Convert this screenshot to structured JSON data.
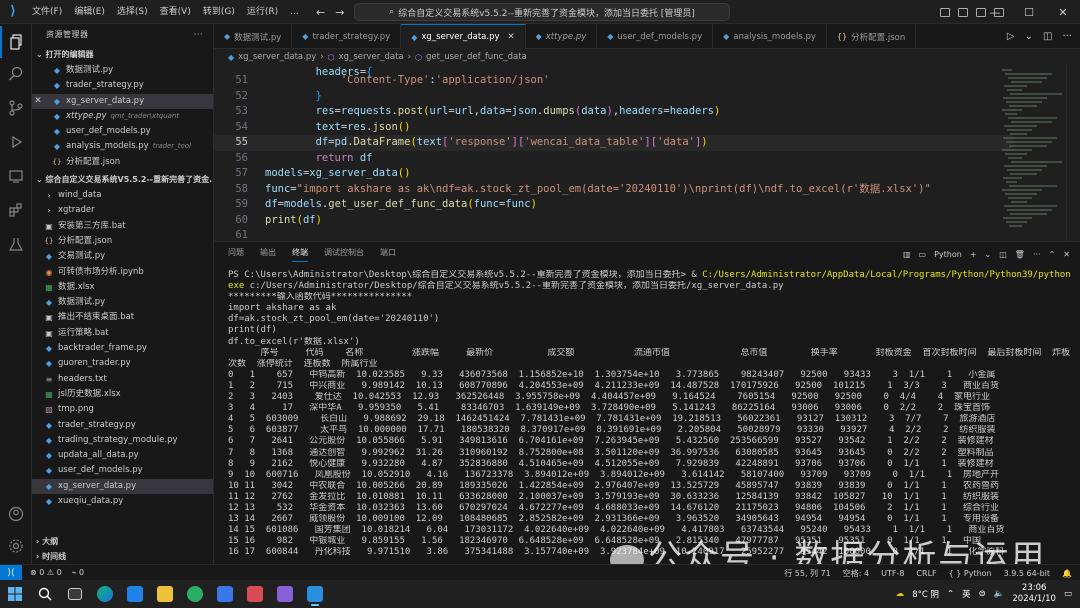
{
  "titlebar": {
    "menus": [
      "文件(F)",
      "编辑(E)",
      "选择(S)",
      "查看(V)",
      "转到(G)",
      "运行(R)",
      "..."
    ],
    "command_center": "综合自定义交易系统v5.5.2--重新完善了资金模块，添加当日委托 [管理员]"
  },
  "sidebar": {
    "title": "资源管理器",
    "open_editors_header": "打开的编辑器",
    "open_editors": [
      {
        "name": "数据测试.py",
        "type": "py",
        "hint": "",
        "italic": false
      },
      {
        "name": "trader_strategy.py",
        "type": "py",
        "hint": "",
        "italic": false
      },
      {
        "name": "xg_server_data.py",
        "type": "py",
        "hint": "",
        "italic": false
      },
      {
        "name": "xttype.py",
        "type": "py",
        "hint": "qmt_trader\\xtquant",
        "italic": true
      },
      {
        "name": "user_def_models.py",
        "type": "py",
        "hint": "",
        "italic": false
      },
      {
        "name": "analysis_models.py",
        "type": "py",
        "hint": "trader_tool",
        "italic": false
      },
      {
        "name": "分析配置.json",
        "type": "json",
        "hint": "",
        "italic": false
      }
    ],
    "workspace_header": "综合自定义交易系统V5.5.2--重新完善了资金...",
    "files": [
      {
        "name": "wind_data",
        "type": "folder"
      },
      {
        "name": "xgtrader",
        "type": "folder"
      },
      {
        "name": "安装第三方库.bat",
        "type": "bat"
      },
      {
        "name": "分析配置.json",
        "type": "json"
      },
      {
        "name": "交易测试.py",
        "type": "py"
      },
      {
        "name": "可转债市场分析.ipynb",
        "type": "ipynb"
      },
      {
        "name": "数据.xlsx",
        "type": "xlsx"
      },
      {
        "name": "数据测试.py",
        "type": "py"
      },
      {
        "name": "推出不结束桌面.bat",
        "type": "bat"
      },
      {
        "name": "运行策略.bat",
        "type": "bat"
      },
      {
        "name": "backtrader_frame.py",
        "type": "py"
      },
      {
        "name": "guoren_trader.py",
        "type": "py"
      },
      {
        "name": "headers.txt",
        "type": "txt"
      },
      {
        "name": "jsl历史数据.xlsx",
        "type": "xlsx"
      },
      {
        "name": "tmp.png",
        "type": "png"
      },
      {
        "name": "trader_strategy.py",
        "type": "py"
      },
      {
        "name": "trading_strategy_module.py",
        "type": "py"
      },
      {
        "name": "updata_all_data.py",
        "type": "py"
      },
      {
        "name": "user_def_models.py",
        "type": "py"
      },
      {
        "name": "xg_server_data.py",
        "type": "py"
      },
      {
        "name": "xueqiu_data.py",
        "type": "py"
      }
    ],
    "outline": "大纲",
    "timeline": "时间线"
  },
  "tabs": [
    {
      "label": "数据测试.py",
      "type": "py",
      "active": false,
      "italic": false
    },
    {
      "label": "trader_strategy.py",
      "type": "py",
      "active": false,
      "italic": false
    },
    {
      "label": "xg_server_data.py",
      "type": "py",
      "active": true,
      "italic": false
    },
    {
      "label": "xttype.py",
      "type": "py",
      "active": false,
      "italic": true
    },
    {
      "label": "user_def_models.py",
      "type": "py",
      "active": false,
      "italic": false
    },
    {
      "label": "analysis_models.py",
      "type": "py",
      "active": false,
      "italic": false
    },
    {
      "label": "分析配置.json",
      "type": "json",
      "active": false,
      "italic": false
    }
  ],
  "breadcrumb": [
    "xg_server_data.py",
    "xg_server_data",
    "get_user_def_func_data"
  ],
  "code_lines": [
    {
      "n": "51",
      "html": "<span class=\"str\">            'Content-Type'</span><span class=\"op\">:</span><span class=\"str\">'application/json'</span>"
    },
    {
      "n": "52",
      "html": "<span class=\"br2\">        }</span>"
    },
    {
      "n": "53",
      "html": "<span class=\"var\">        res</span><span class=\"op\">=</span><span class=\"var\">requests</span><span class=\"op\">.</span><span class=\"fn\">post</span><span class=\"br3\">(</span><span class=\"var\">url</span><span class=\"op\">=</span><span class=\"var\">url</span><span class=\"op\">,</span><span class=\"var\">data</span><span class=\"op\">=</span><span class=\"var\">json</span><span class=\"op\">.</span><span class=\"fn\">dumps</span><span class=\"br\">(</span><span class=\"var\">data</span><span class=\"br\">)</span><span class=\"op\">,</span><span class=\"var\">headers</span><span class=\"op\">=</span><span class=\"var\">headers</span><span class=\"br3\">)</span>"
    },
    {
      "n": "54",
      "html": "<span class=\"var\">        text</span><span class=\"op\">=</span><span class=\"var\">res</span><span class=\"op\">.</span><span class=\"fn\">json</span><span class=\"br3\">()</span>"
    },
    {
      "n": "55",
      "html": "<span class=\"var\">        df</span><span class=\"op\">=</span><span class=\"var\">pd</span><span class=\"op\">.</span><span class=\"fn\">DataFrame</span><span class=\"br3\">(</span><span class=\"var\">text</span><span class=\"br\">[</span><span class=\"str\">'response'</span><span class=\"br\">]</span><span class=\"br\">[</span><span class=\"str\">'wencai_data_table'</span><span class=\"br\">]</span><span class=\"br\">[</span><span class=\"str\">'data'</span><span class=\"br\">]</span><span class=\"br3\">)</span>"
    },
    {
      "n": "56",
      "html": "<span class=\"kw\">        return</span><span class=\"var\"> df</span>"
    },
    {
      "n": "57",
      "html": "<span class=\"var\">models</span><span class=\"op\">=</span><span class=\"var\">xg_server_data</span><span class=\"br3\">()</span>"
    },
    {
      "n": "58",
      "html": "<span class=\"var\">func</span><span class=\"op\">=</span><span class=\"str\">\"import akshare as ak\\ndf=ak.stock_zt_pool_em(date='20240110')\\nprint(df)\\ndf.to_excel(r'数据.xlsx')\"</span>"
    },
    {
      "n": "59",
      "html": "<span class=\"var\">df</span><span class=\"op\">=</span><span class=\"var\">models</span><span class=\"op\">.</span><span class=\"fn\">get_user_def_func_data</span><span class=\"br3\">(</span><span class=\"var\">func</span><span class=\"op\">=</span><span class=\"var\">func</span><span class=\"br3\">)</span>"
    },
    {
      "n": "60",
      "html": "<span class=\"fn\">print</span><span class=\"br3\">(</span><span class=\"var\">df</span><span class=\"br3\">)</span>"
    },
    {
      "n": "61",
      "html": ""
    }
  ],
  "current_line": "55",
  "panel": {
    "tabs": [
      "问题",
      "输出",
      "终端",
      "调试控制台",
      "端口"
    ],
    "active_tab": "终端",
    "shell_label": "Python",
    "terminal_lines": [
      "PS C:\\Users\\Administrator\\Desktop\\综合自定义交易系统v5.5.2--重新完善了资金模块，添加当日委托> & C:/Users/Administrator/AppData/Local/Programs/Python/Python39/python.",
      "exe c:/Users/Administrator/Desktop/综合自定义交易系统v5.5.2--重新完善了资金模块，添加当日委托/xg_server_data.py",
      "*********输入函数代码***************",
      "import akshare as ak",
      "df=ak.stock_zt_pool_em(date='20240110')",
      "print(df)",
      "df.to_excel(r'数据.xlsx')",
      "      序号     代码    名称         涨跌幅     最新价          成交额           流通市值             总市值        换手率       封板资金  首次封板时间  最后封板时间  炸板",
      "次数  涨停统计  连板数  所属行业",
      "0   1    657   中钨高新  10.023585   9.33   436073568  1.156852e+10  1.303754e+10   3.773865    98243407   92500   93433    3  1/1    1   小金属",
      "1   2    715   中兴商业   9.989142  10.13   608770896  4.204553e+09  4.211233e+09  14.487528  170175926   92500  101215    1  3/3    3   商业百货",
      "2   3   2403    爱仕达  10.042553  12.93   362526448  3.955758e+09  4.404457e+09   9.164524    7605154   92500   92500    0  4/4    4  家电行业",
      "3   4     17   深中华A   9.959350   5.41    83346703  1.639149e+09  3.728490e+09   5.141243   86225164   93006   93006    0  2/2    2  珠宝首饰",
      "4   5  603009    长白山   9.988692  29.18  1462451424  7.781431e+09  7.781431e+09  19.218513   56022361   93127  130312    3  7/7    7  旅游酒店",
      "5   6  603877    太平鸟  10.000000  17.71   180538320  8.370917e+09  8.391691e+09   2.205804   50028979   93330   93927    4  2/2    2  纺织服装",
      "6   7   2641   公元股份  10.055866   5.91   349813616  6.704161e+09  7.263945e+09   5.432560  253566599   93527   93542    1  2/2    2  装修建材",
      "7   8   1368   通达创智   9.992962  31.26   310960192  8.752800e+08  3.501120e+09  36.997536   63080585   93645   93645    0  2/2    2  塑料制品",
      "8   9   2162   悦心健康   9.932280   4.87   352836880  4.510465e+09  4.512055e+09   7.929839   42248891   93706   93706    0  1/1    1  装修建材",
      "9  10  600716   凤凰股份  10.052910   4.16   136723378  3.894012e+09  3.894012e+09   3.614142   58107400   93709   93709    0  1/1    1  房地产开",
      "10 11   3042   中农联合  10.005266  20.89   189335026  1.422854e+09  2.976407e+09  13.525729   45895747   93839   93839    0  1/1    1   农药兽药",
      "11 12   2762   金发拉比  10.010881  10.11   633628000  2.100037e+09  3.579193e+09  30.633236   12584139   93842  105827   10  1/1    1   纺织服装",
      "12 13    532   华金资本  10.032363  13.60   670297024  4.672277e+09  4.688033e+09  14.676120   21175023   94806  104506    2  1/1    1   综合行业",
      "13 14   2667   威领股份  10.009100  12.09   108480685  2.852582e+09  2.931366e+09   3.963520   34905643   94954   94954    0  1/1    1   专用设备",
      "14 15  601086   国芳集团  10.018214   6.04   173031172  4.022640e+09  4.022640e+09   4.417803   63743544   95240   95433    1  1/1    1   商业百货",
      "15 16    982   中银城业   9.859155   1.56   182346970  6.648528e+09  6.648528e+09   2.815340   47977787   95351   95351    0  1/1    1   中国",
      "16 17  600844   丹化科技   9.971510   3.86   375341488  3.157740e+09  3.923784e+09  10.240917   25952277   95442  100000    0  1/1    1   化学原料"
    ]
  },
  "watermark": "公众号 · 数据分析与运用",
  "statusbar": {
    "remote": "⟩⟨",
    "errors": "⊗ 0 ⚠ 0",
    "ports": "⌁ 0",
    "position": "行 55, 列 71",
    "spaces": "空格: 4",
    "encoding": "UTF-8",
    "eol": "CRLF",
    "language": "Python",
    "interpreter": "3.9.5 64-bit"
  },
  "taskbar": {
    "weather": "8°C 阴",
    "lang": "英",
    "time": "23:06",
    "date": "2024/1/10"
  }
}
